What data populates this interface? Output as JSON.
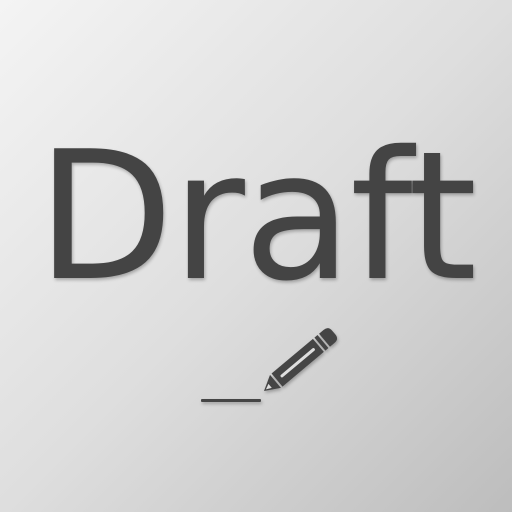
{
  "icon": {
    "word": "Draft",
    "symbol": "pencil-icon",
    "colors": {
      "background_light": "#f4f4f4",
      "background_dark": "#bdbdbd",
      "foreground": "#444444"
    }
  }
}
